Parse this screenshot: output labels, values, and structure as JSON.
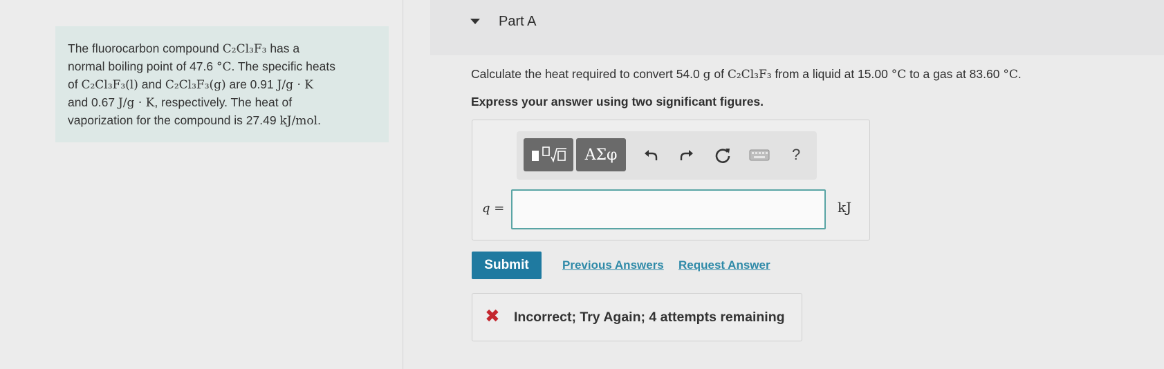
{
  "problem": {
    "line1_pre": "The fluorocarbon compound ",
    "compound": "C₂Cl₃F₃",
    "line1_post": " has a",
    "line2_pre": "normal boiling point of 47.6 ",
    "boiling_unit": "°C",
    "line2_post": ". The specific heats",
    "line3_pre": "of ",
    "liquid": "C₂Cl₃F₃(l)",
    "line3_mid": " and ",
    "gas": "C₂Cl₃F₃(g)",
    "line3_post": " are 0.91 ",
    "heat_unit1": "J/g · K",
    "line4_pre": "and 0.67 ",
    "heat_unit2": "J/g · K",
    "line4_post": ", respectively. The heat of",
    "line5_pre": "vaporization for the compound is 27.49 ",
    "vap_unit": "kJ/mol",
    "line5_post": "."
  },
  "part": {
    "title": "Part A"
  },
  "question": {
    "pre": "Calculate the heat required to convert 54.0 ",
    "mass_unit": "g",
    "mid1": " of ",
    "compound": "C₂Cl₃F₃",
    "mid2": " from a liquid at 15.00 ",
    "temp_unit1": "°C",
    "mid3": " to a gas at 83.60 ",
    "temp_unit2": "°C",
    "post": "."
  },
  "instruction": "Express your answer using two significant figures.",
  "toolbar": {
    "greek_label": "ΑΣφ",
    "undo_icon": "undo-icon",
    "redo_icon": "redo-icon",
    "reset_icon": "reset-icon",
    "keyboard_icon": "keyboard-icon",
    "help_label": "?"
  },
  "answer": {
    "variable": "q",
    "equals": " =",
    "value": "",
    "unit": "kJ"
  },
  "actions": {
    "submit": "Submit",
    "previous": "Previous Answers",
    "request": "Request Answer"
  },
  "feedback": {
    "icon": "x-icon",
    "message": "Incorrect; Try Again; 4 attempts remaining",
    "color": "#c4262e"
  },
  "colors": {
    "submit_bg": "#1f7aa0",
    "link": "#2f8aa8",
    "input_border": "#5aa5a5",
    "problem_bg": "#dde8e6"
  }
}
